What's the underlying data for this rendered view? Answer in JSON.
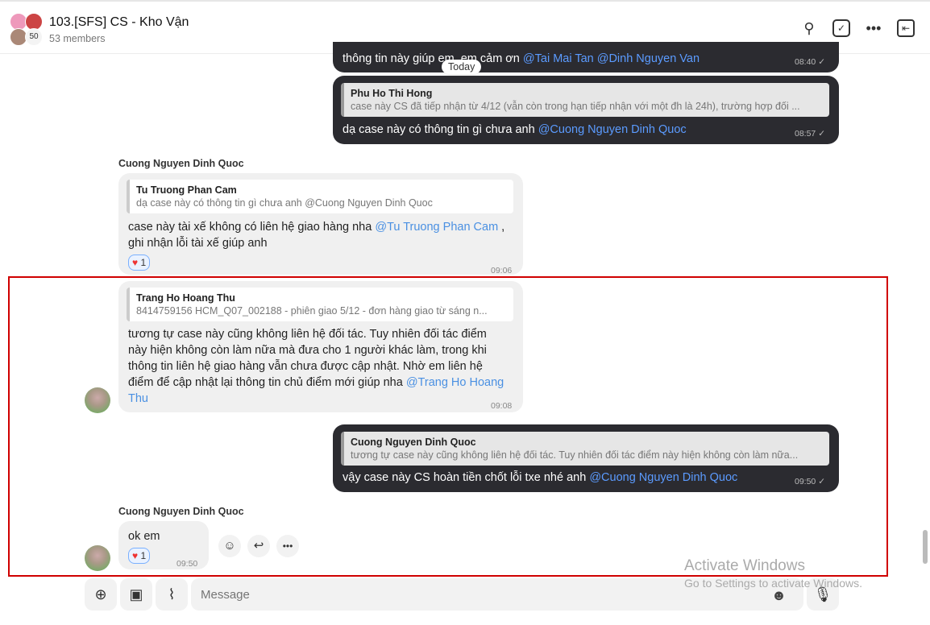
{
  "header": {
    "title": "103.[SFS] CS - Kho Vận",
    "members": "53 members",
    "avatar_count": "50",
    "icons": [
      "search-icon",
      "task-check-icon",
      "more-icon",
      "collapse-panel-icon"
    ]
  },
  "date_divider": "Today",
  "messages": [
    {
      "type": "sent",
      "text": "thông tin này giúp em, em cảm ơn ",
      "mentions": "@Tai Mai Tan @Dinh Nguyen Van",
      "time": "08:40"
    },
    {
      "type": "sent",
      "quote_author": "Phu Ho Thi Hong",
      "quote_text": "case này CS đã tiếp nhận từ 4/12 (vẫn còn trong hạn tiếp nhận với một đh là 24h), trường hợp đối ...",
      "text": "dạ case này có thông tin gì chưa anh ",
      "mentions": "@Cuong Nguyen Dinh Quoc",
      "time": "08:57"
    },
    {
      "type": "received",
      "sender": "Cuong Nguyen Dinh Quoc",
      "quote_author": "Tu Truong Phan Cam",
      "quote_text": "dạ case này có thông tin gì chưa anh @Cuong Nguyen Dinh Quoc",
      "text": "case này tài xế không có liên hệ giao hàng nha ",
      "mentions": "@Tu Truong Phan Cam",
      "text2": " , ghi nhận lỗi tài xế giúp anh",
      "reaction": "1",
      "time": "09:06"
    },
    {
      "type": "received",
      "quote_author": "Trang Ho Hoang Thu",
      "quote_text": "8414759156 HCM_Q07_002188 - phiên giao 5/12 - đơn hàng giao từ sáng n...",
      "text": "tương tự case này cũng không liên hệ đối tác. Tuy nhiên đối tác điểm này hiện không còn làm nữa mà đưa cho 1 người khác làm, trong khi thông tin liên hệ giao hàng vẫn chưa được cập nhật. Nhờ em liên hệ điểm để cập nhật lại thông tin chủ điểm mới giúp nha ",
      "mentions": "@Trang Ho Hoang Thu",
      "time": "09:08"
    },
    {
      "type": "sent",
      "quote_author": "Cuong Nguyen Dinh Quoc",
      "quote_text": "tương tự case này cũng không liên hệ đối tác. Tuy nhiên đối tác điểm này hiện không còn làm nữa...",
      "text": "vậy case này CS hoàn tiền chốt lỗi txe nhé anh ",
      "mentions": "@Cuong Nguyen Dinh Quoc",
      "time": "09:50"
    },
    {
      "type": "received",
      "sender": "Cuong Nguyen Dinh Quoc",
      "text": "ok em",
      "reaction": "1",
      "time": "09:50"
    }
  ],
  "composer": {
    "placeholder": "Message",
    "buttons": [
      "add-icon",
      "image-icon",
      "attach-icon"
    ]
  },
  "watermark": {
    "line1": "Activate Windows",
    "line2": "Go to Settings to activate Windows."
  }
}
